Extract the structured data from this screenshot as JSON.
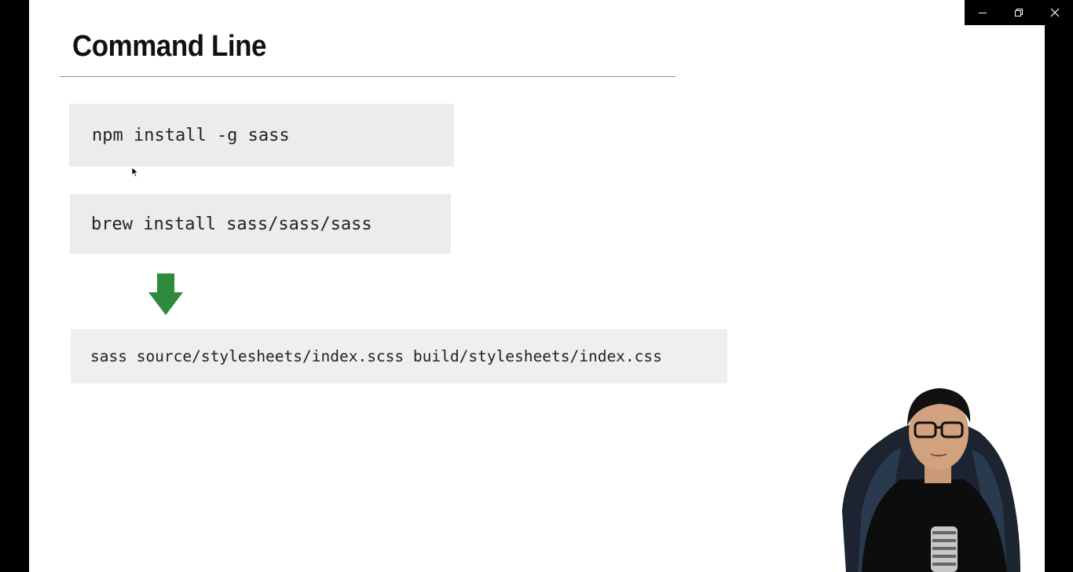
{
  "slide": {
    "title": "Command Line",
    "commands": [
      "npm install -g sass",
      "brew install sass/sass/sass",
      "sass source/stylesheets/index.scss build/stylesheets/index.css"
    ]
  },
  "colors": {
    "arrow": "#2e8b3e",
    "code_background": "#ececec",
    "slide_background": "#ffffff",
    "window_chrome": "#000000"
  },
  "icons": {
    "arrow": "down-arrow-icon",
    "minimize": "minimize-icon",
    "restore": "restore-icon",
    "close": "close-icon",
    "cursor": "mouse-cursor-icon"
  }
}
